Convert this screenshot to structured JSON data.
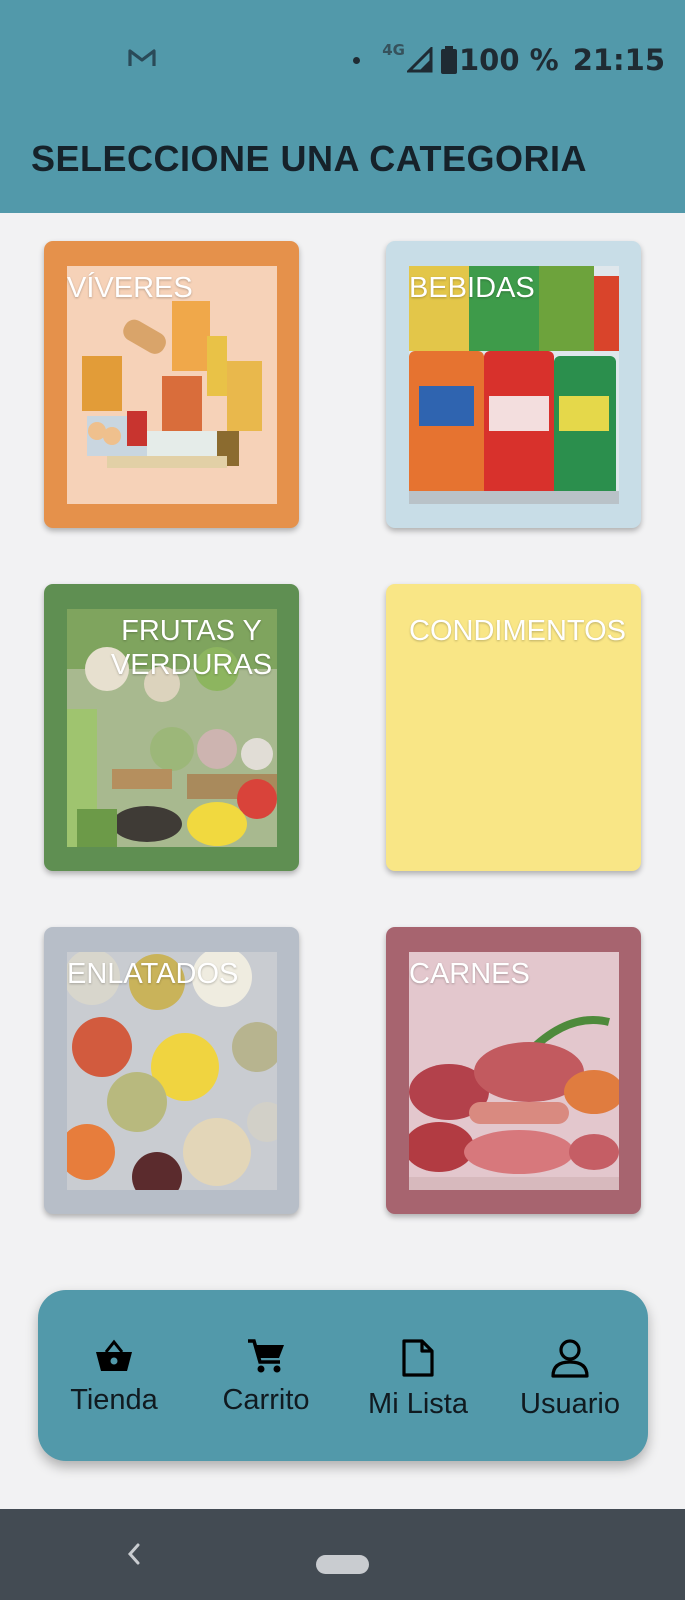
{
  "status_bar": {
    "battery": "100 %",
    "time": "21:15",
    "network": "4G",
    "icons": [
      "gmail-icon",
      "dot-icon",
      "signal-icon",
      "battery-icon"
    ]
  },
  "header": {
    "title": "SELECCIONE UNA CATEGORIA",
    "color": "#5299aa"
  },
  "categories": [
    {
      "label": "VÍVERES",
      "color": "#e5914b",
      "image": "groceries-photo"
    },
    {
      "label": "BEBIDAS",
      "color": "#c8dde7",
      "image": "soda-cans-photo"
    },
    {
      "label": "FRUTAS Y VERDURAS",
      "color": "#5f8f52",
      "image": "vegetables-photo"
    },
    {
      "label": "CONDIMENTOS",
      "color": "#f9e686",
      "image": ""
    },
    {
      "label": "ENLATADOS",
      "color": "#b7bec8",
      "image": "canned-food-photo"
    },
    {
      "label": "CARNES",
      "color": "#a7646f",
      "image": "meat-photo"
    }
  ],
  "bottom_nav": [
    {
      "label": "Tienda",
      "icon": "basket-icon"
    },
    {
      "label": "Carrito",
      "icon": "cart-icon"
    },
    {
      "label": "Mi Lista",
      "icon": "document-icon"
    },
    {
      "label": "Usuario",
      "icon": "user-icon"
    }
  ],
  "system_nav": {
    "icons": [
      "back-icon",
      "home-pill-icon"
    ]
  }
}
